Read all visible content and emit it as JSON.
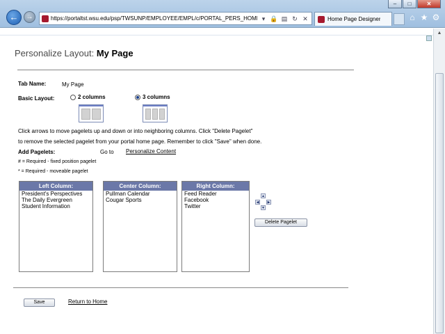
{
  "browser": {
    "url": "https://portaltst.wsu.edu/psp/TWSUNP/EMPLOYEE/EMPL/c/PORTAL_PERS_HOMEPAGE",
    "tab_label": "Home Page Designer",
    "back_icon": "back-arrow-icon",
    "forward_icon": "forward-arrow-icon",
    "window_buttons": [
      "minimize",
      "maximize",
      "close"
    ]
  },
  "page": {
    "title_prefix": "Personalize Layout:",
    "title_name": "My Page",
    "tab_name_label": "Tab Name:",
    "tab_name_value": "My Page",
    "basic_layout_label": "Basic Layout:",
    "layout_options": [
      {
        "label": "2 columns",
        "selected": false
      },
      {
        "label": "3 columns",
        "selected": true
      }
    ],
    "instructions_line1": "Click arrows to move pagelets up and down or into neighboring columns. Click \"Delete Pagelet\"",
    "instructions_line2": "to remove the selected pagelet from your portal home page. Remember to click \"Save\" when done.",
    "add_pagelets_label": "Add Pagelets:",
    "go_to_text": "Go to",
    "personalize_content_link": "Personalize Content",
    "legend_fixed": "# = Required - fixed position pagelet",
    "legend_moveable": "* = Required - moveable pagelet",
    "columns": [
      {
        "header": "Left Column:",
        "items": [
          "President's Perspectives",
          "The Daily Evergreen",
          "Student Information"
        ]
      },
      {
        "header": "Center Column:",
        "items": [
          "Pullman Calendar",
          "Cougar Sports"
        ]
      },
      {
        "header": "Right Column:",
        "items": [
          "Feed Reader",
          "Facebook",
          "Twitter"
        ]
      }
    ],
    "delete_button": "Delete Pagelet",
    "save_button": "Save",
    "return_link": "Return to Home"
  },
  "colors": {
    "column_header": "#6b78a8",
    "chrome": "#9fbfe0"
  }
}
